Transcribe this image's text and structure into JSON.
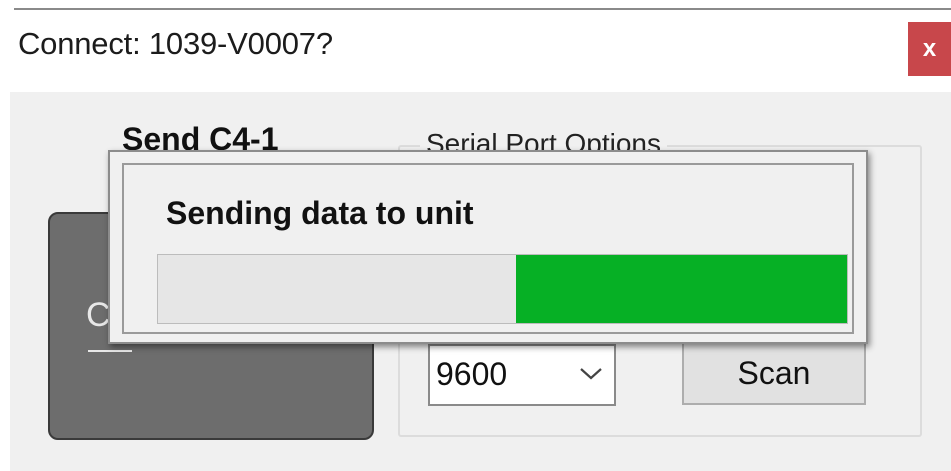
{
  "window": {
    "title": "Connect: 1039-V0007?",
    "close_label": "x"
  },
  "main": {
    "send_label": "Send C4-1",
    "group_title": "Serial Port Options",
    "big_button_char": "C",
    "baud_value": "9600",
    "scan_label": "Scan"
  },
  "progress": {
    "message": "Sending data to unit",
    "fill_start": 0.52,
    "fill_end": 1.0,
    "fill_color": "#06b025"
  },
  "icons": {
    "close": "close-icon",
    "dropdown": "chevron-down-icon"
  }
}
